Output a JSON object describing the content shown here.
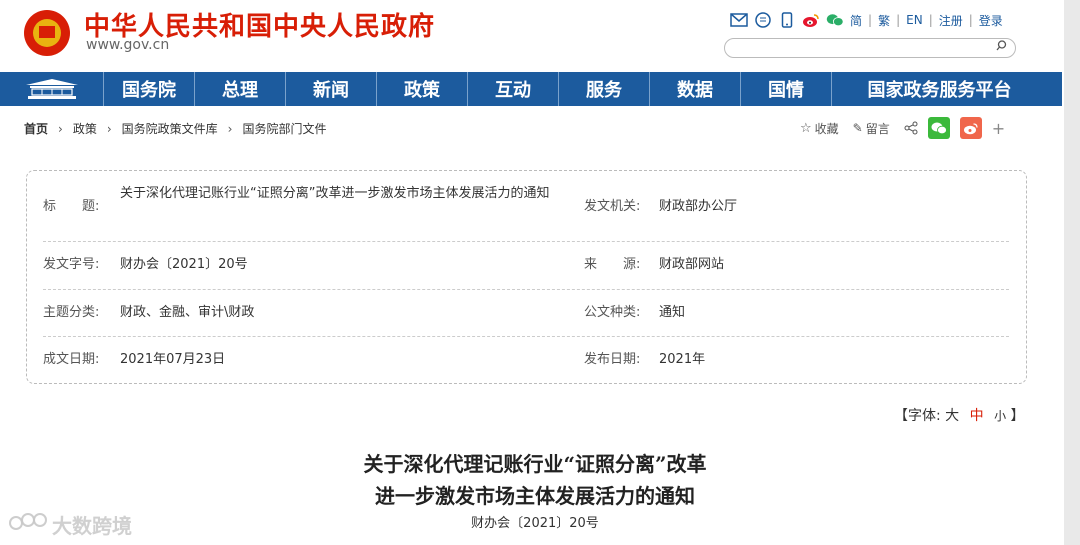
{
  "header": {
    "title": "中华人民共和国中央人民政府",
    "url": "www.gov.cn",
    "tools": {
      "icons": [
        "mail-icon",
        "chat-bubble-icon",
        "phone-icon",
        "weibo-icon",
        "wechat-icon"
      ],
      "links": [
        "简",
        "繁",
        "EN",
        "注册",
        "登录"
      ]
    },
    "search_placeholder": ""
  },
  "nav": {
    "items": [
      "国务院",
      "总理",
      "新闻",
      "政策",
      "互动",
      "服务",
      "数据",
      "国情",
      "国家政务服务平台"
    ]
  },
  "breadcrumb": [
    "首页",
    "政策",
    "国务院政策文件库",
    "国务院部门文件"
  ],
  "share": {
    "favorite": "收藏",
    "comment": "留言",
    "plus": "+"
  },
  "info": {
    "title_label": "标　　题:",
    "title_value": "关于深化代理记账行业“证照分离”改革进一步激发市场主体发展活力的通知",
    "issuer_label": "发文机关:",
    "issuer_value": "财政部办公厅",
    "docno_label": "发文字号:",
    "docno_value": "财办会〔2021〕20号",
    "source_label": "来　　源:",
    "source_value": "财政部网站",
    "topic_label": "主题分类:",
    "topic_value": "财政、金融、审计\\财政",
    "type_label": "公文种类:",
    "type_value": "通知",
    "written_label": "成文日期:",
    "written_value": "2021年07月23日",
    "published_label": "发布日期:",
    "published_value": "2021年"
  },
  "fontsize": {
    "prefix": "【字体:",
    "large": "大",
    "medium": "中",
    "small": "小",
    "suffix": "】"
  },
  "article": {
    "title_line1": "关于深化代理记账行业“证照分离”改革",
    "title_line2": "进一步激发市场主体发展活力的通知",
    "doc_number": "财办会〔2021〕20号"
  },
  "watermark": "大数跨境",
  "colors": {
    "brand_red": "#d81e06",
    "nav_blue": "#1c5b9e",
    "wechat_green": "#3bb93b",
    "weibo_orange": "#f0664b"
  }
}
